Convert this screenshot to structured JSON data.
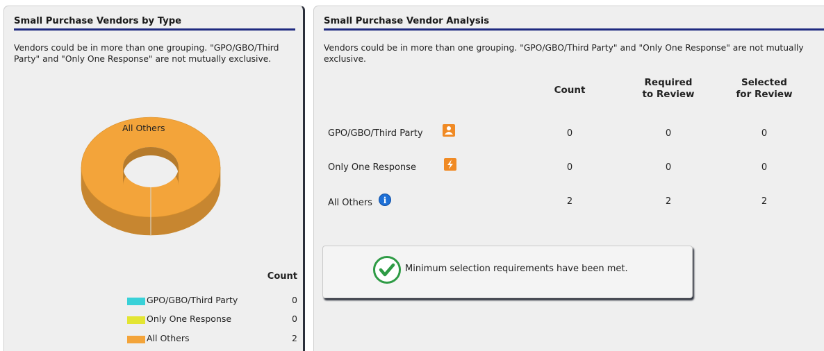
{
  "left_panel": {
    "title": "Small Purchase Vendors by Type",
    "description": "Vendors could be in more than one grouping. \"GPO/GBO/Third Party\" and \"Only One Response\" are not mutually exclusive.",
    "chart_data": {
      "type": "pie",
      "style": "3d-donut",
      "slices": [
        {
          "label": "GPO/GBO/Third Party",
          "value": 0,
          "color": "#39d1d8"
        },
        {
          "label": "Only One Response",
          "value": 0,
          "color": "#e3e533"
        },
        {
          "label": "All Others",
          "value": 2,
          "color": "#f3a43a"
        }
      ],
      "data_label": "All Others"
    },
    "legend": {
      "count_header": "Count",
      "items": [
        {
          "label": "GPO/GBO/Third Party",
          "count": "0",
          "color": "#39d1d8"
        },
        {
          "label": "Only One Response",
          "count": "0",
          "color": "#e3e533"
        },
        {
          "label": "All Others",
          "count": "2",
          "color": "#f3a43a"
        }
      ]
    }
  },
  "right_panel": {
    "title": "Small Purchase Vendor Analysis",
    "description": "Vendors could be in more than one grouping. \"GPO/GBO/Third Party\" and \"Only One Response\" are not mutually exclusive.",
    "table": {
      "headers": {
        "count": "Count",
        "required_line1": "Required",
        "required_line2": "to Review",
        "selected_line1": "Selected",
        "selected_line2": "for Review"
      },
      "rows": [
        {
          "label": "GPO/GBO/Third Party",
          "icon": "person-icon",
          "count": "0",
          "required": "0",
          "selected": "0"
        },
        {
          "label": "Only One Response",
          "icon": "lightning-icon",
          "count": "0",
          "required": "0",
          "selected": "0"
        },
        {
          "label": "All Others",
          "icon": "info-icon",
          "count": "2",
          "required": "2",
          "selected": "2"
        }
      ]
    },
    "status": {
      "icon": "checkmark-icon",
      "text": "Minimum selection requirements have been met.",
      "color": "#2e9b45"
    }
  }
}
